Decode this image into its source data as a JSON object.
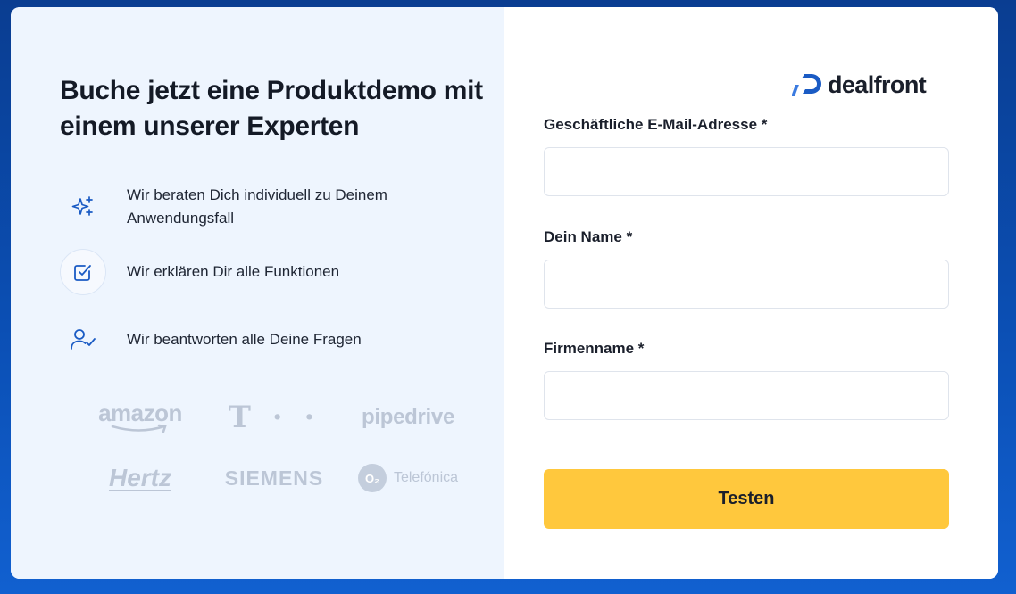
{
  "headline": "Buche jetzt eine Produktdemo mit einem unserer Experten",
  "features": [
    {
      "icon": "sparkles-icon",
      "text": "Wir beraten Dich individuell zu Deinem Anwendungsfall"
    },
    {
      "icon": "checkbox-icon",
      "text": "Wir erklären Dir alle Funktionen"
    },
    {
      "icon": "user-check-icon",
      "text": "Wir beantworten alle Deine Fragen"
    }
  ],
  "customer_logos": [
    "amazon",
    "T · ·",
    "pipedrive",
    "Hertz",
    "SIEMENS",
    "Telefónica"
  ],
  "brand": {
    "name": "dealfront"
  },
  "form": {
    "email_label": "Geschäftliche E-Mail-Adresse *",
    "email_value": "",
    "name_label": "Dein Name *",
    "name_value": "",
    "company_label": "Firmenname *",
    "company_value": "",
    "submit_label": "Testen"
  },
  "colors": {
    "accent_button": "#ffc83d",
    "background": "#0b4fb4",
    "left_panel": "#eef5fe",
    "icon_blue": "#1a5bc4"
  }
}
